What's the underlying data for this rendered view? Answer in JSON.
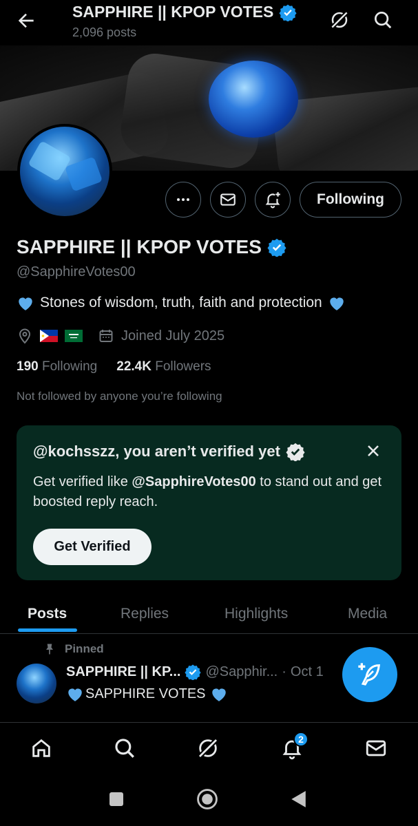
{
  "header": {
    "title": "SAPPHIRE || KPOP VOTES",
    "post_count": "2,096 posts"
  },
  "profile": {
    "name": "SAPPHIRE || KPOP VOTES",
    "handle": "@SapphireVotes00",
    "bio": "Stones of wisdom, truth, faith and protection",
    "joined": "Joined July 2025",
    "following_count": "190",
    "following_label": "Following",
    "followers_count": "22.4K",
    "followers_label": "Followers",
    "not_followed_text": "Not followed by anyone you’re following",
    "follow_button_label": "Following"
  },
  "verify_card": {
    "title": "@kochsszz, you aren’t verified yet",
    "text_before": "Get verified like ",
    "text_handle": "@SapphireVotes00",
    "text_after": " to stand out and get boosted reply reach.",
    "button_label": "Get Verified"
  },
  "tabs": [
    {
      "label": "Posts",
      "active": true
    },
    {
      "label": "Replies",
      "active": false
    },
    {
      "label": "Highlights",
      "active": false
    },
    {
      "label": "Media",
      "active": false
    }
  ],
  "pinned_post": {
    "pinned_label": "Pinned",
    "author_name": "SAPPHIRE || KP...",
    "author_handle": "@Sapphir...",
    "separator": "·",
    "date": "Oct 1",
    "text": "SAPPHIRE VOTES"
  },
  "bottom_nav": {
    "notification_badge": "2"
  },
  "colors": {
    "accent": "#1d9bf0",
    "verify_card_bg": "#072a20",
    "muted_text": "#71767b"
  }
}
